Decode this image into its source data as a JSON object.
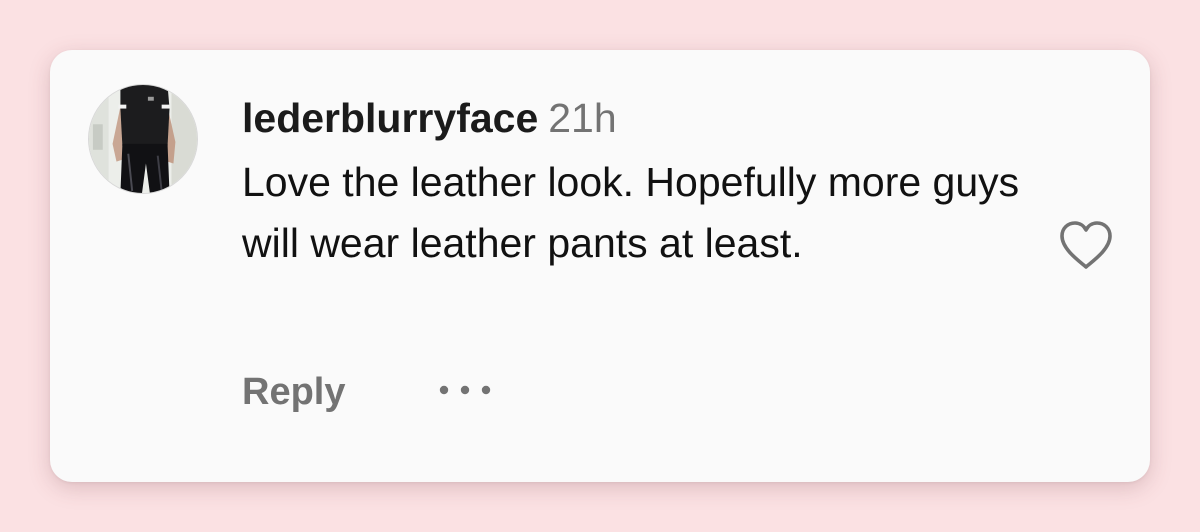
{
  "comment": {
    "username": "lederblurryface",
    "timestamp": "21h",
    "text": "Love the leather look. Hopefully more guys will wear leather pants at least.",
    "reply_label": "Reply",
    "icons": {
      "avatar": "user-avatar",
      "like": "heart-icon",
      "more": "more-options-icon"
    }
  },
  "colors": {
    "background": "#fbe1e3",
    "card": "#fafafa",
    "username": "#1b1b1b",
    "secondary_text": "#737373",
    "body_text": "#111111"
  }
}
